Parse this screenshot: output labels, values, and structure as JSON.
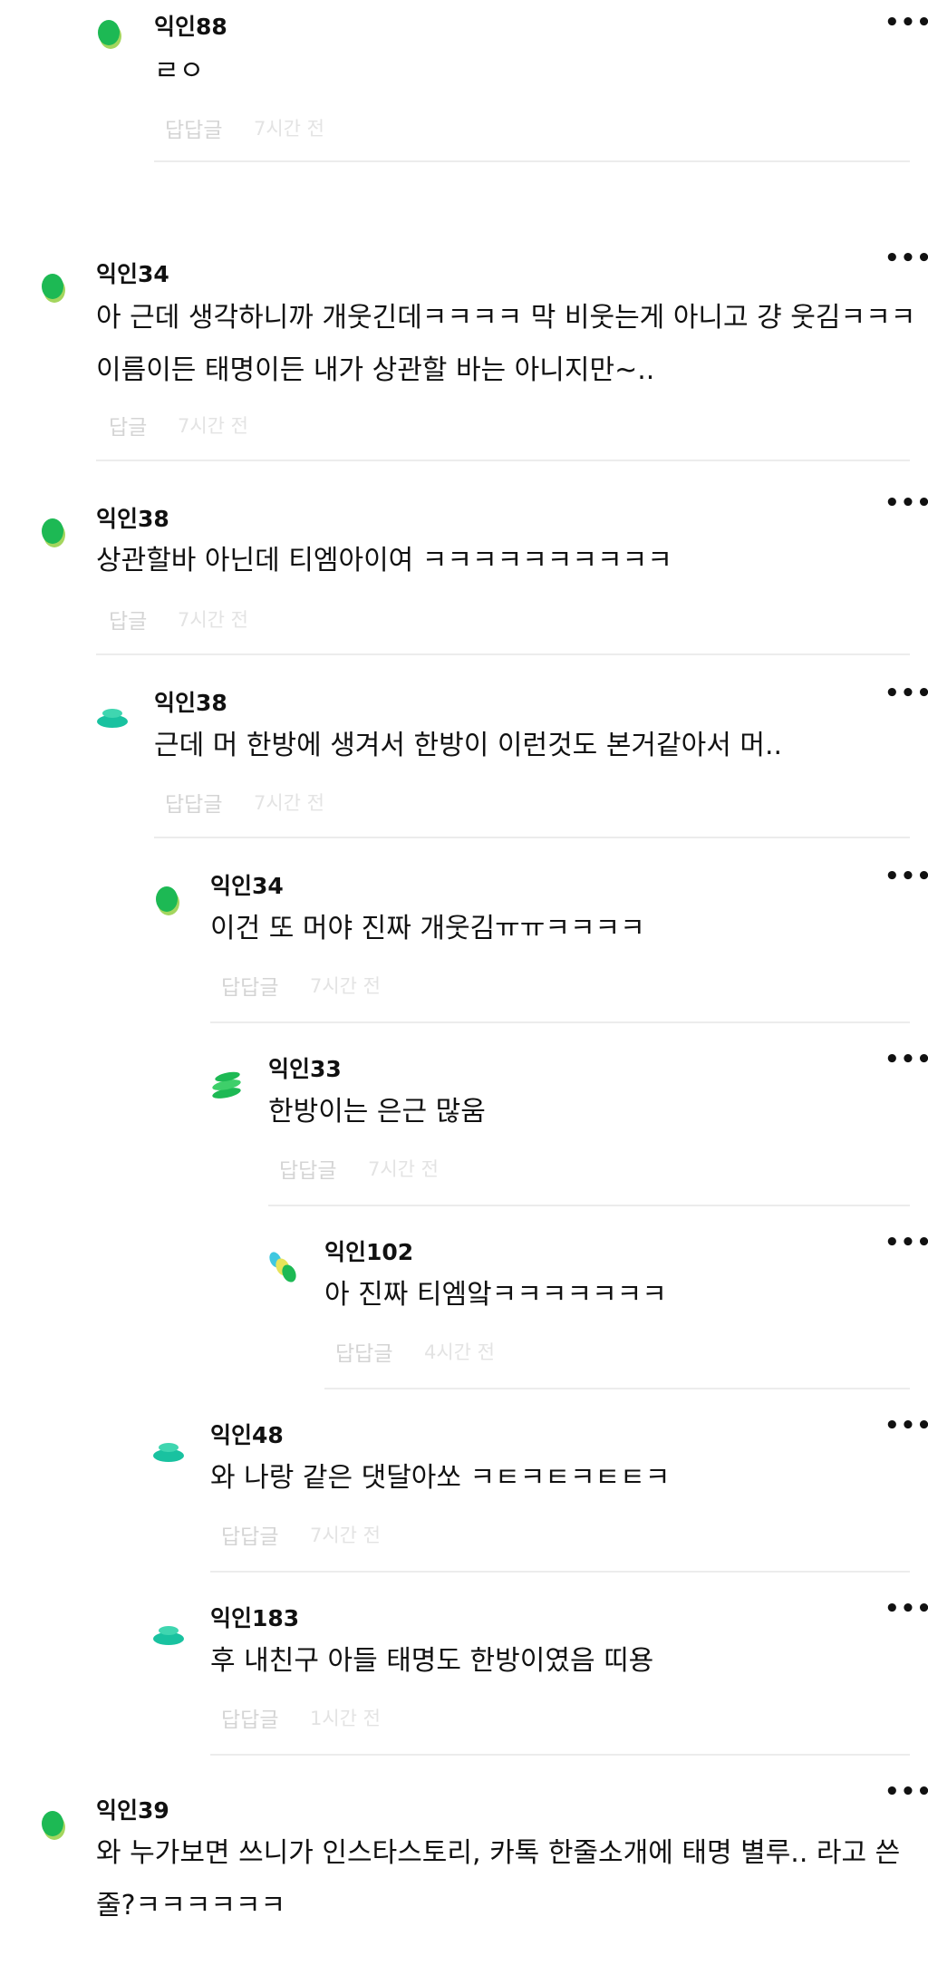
{
  "comments": [
    {
      "author": "익인88",
      "text": [
        "ㄹㅇ"
      ],
      "reply_label": "답답글",
      "time": "7시간 전"
    },
    {
      "author": "익인34",
      "text": [
        "아 근데 생각하니까 개웃긴데ㅋㅋㅋㅋ 막 비웃는게 아니고 걍 웃김ㅋㅋㅋ",
        "이름이든 태명이든 내가 상관할 바는 아니지만~.."
      ],
      "reply_label": "답글",
      "time": "7시간 전"
    },
    {
      "author": "익인38",
      "text": [
        "상관할바 아닌데 티엠아이여 ㅋㅋㅋㅋㅋㅋㅋㅋㅋㅋ"
      ],
      "reply_label": "답글",
      "time": "7시간 전"
    },
    {
      "author": "익인38",
      "text": [
        "근데 머 한방에 생겨서 한방이 이런것도 본거같아서 머.."
      ],
      "reply_label": "답답글",
      "time": "7시간 전"
    },
    {
      "author": "익인34",
      "text": [
        "이건 또 머야 진짜 개웃김ㅠㅠㅋㅋㅋㅋ"
      ],
      "reply_label": "답답글",
      "time": "7시간 전"
    },
    {
      "author": "익인33",
      "text": [
        "한방이는 은근 많움"
      ],
      "reply_label": "답답글",
      "time": "7시간 전"
    },
    {
      "author": "익인102",
      "text": [
        "아 진짜 티엠앜ㅋㅋㅋㅋㅋㅋㅋ"
      ],
      "reply_label": "답답글",
      "time": "4시간 전"
    },
    {
      "author": "익인48",
      "text": [
        "와 나랑 같은 댓달아쏘 ㅋㅌㅋㅌㅋㅌㅌㅋ"
      ],
      "reply_label": "답답글",
      "time": "7시간 전"
    },
    {
      "author": "익인183",
      "text": [
        "후 내친구 아들 태명도 한방이였음 띠용"
      ],
      "reply_label": "답답글",
      "time": "1시간 전"
    },
    {
      "author": "익인39",
      "text": [
        "와 누가보면 쓰니가 인스타스토리, 카톡 한줄소개에 태명 별루.. 라고 쓴",
        "줄?ㅋㅋㅋㅋㅋㅋ"
      ]
    }
  ],
  "more_label": "•••",
  "colors": {
    "green": "#1db954",
    "lime": "#a4d65e",
    "teal": "#19c2a0",
    "cyan": "#3fc8e0",
    "reply": "#d4d4d4",
    "time": "#e3e3e3",
    "divider": "#ececec"
  }
}
